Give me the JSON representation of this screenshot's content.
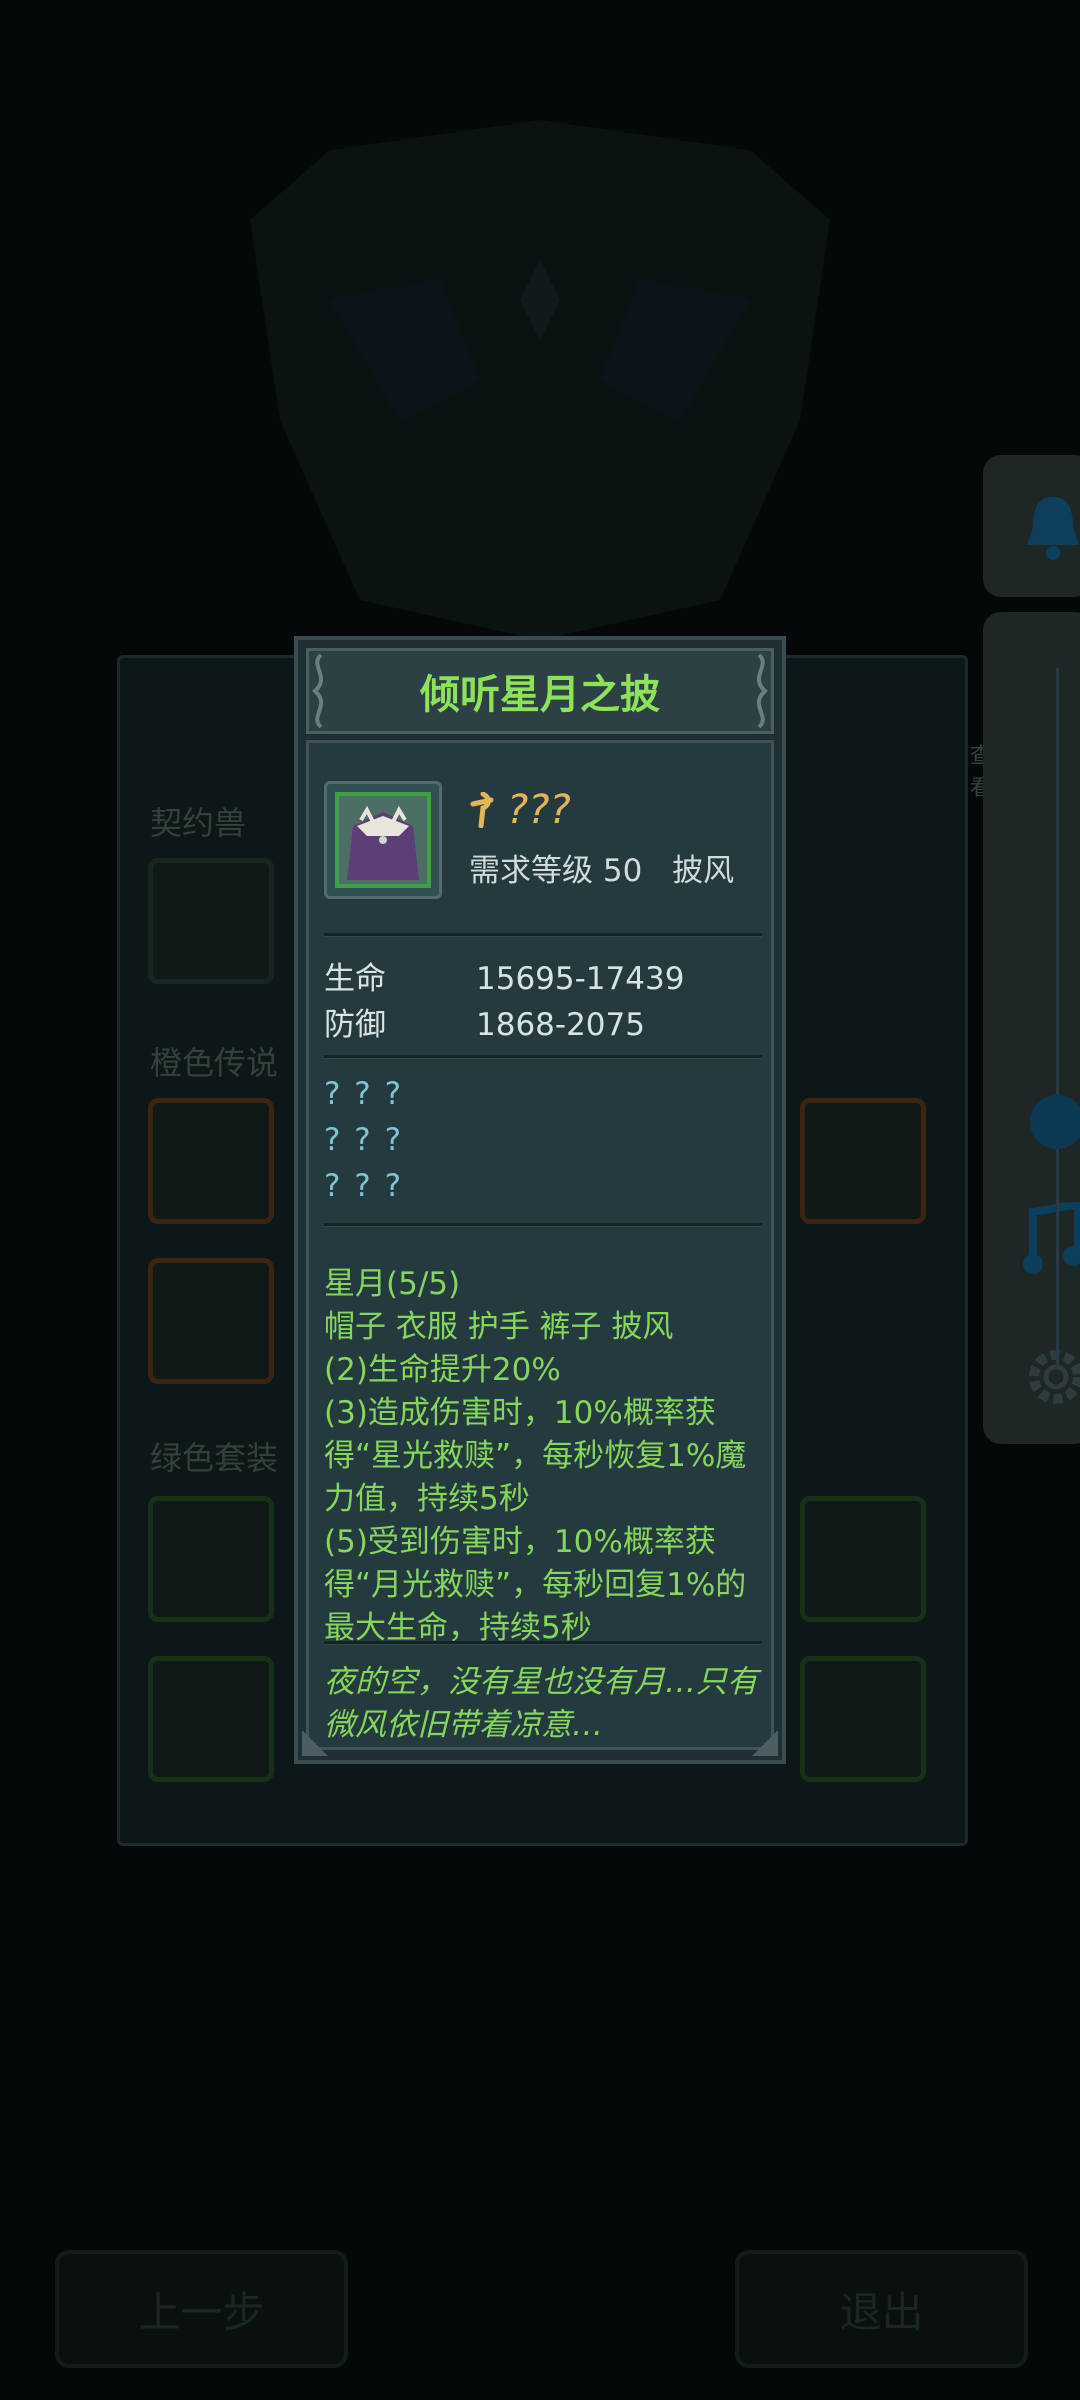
{
  "background": {
    "sections": [
      "契约兽",
      "橙色传说",
      "绿色套装"
    ],
    "side_tab_label": "查看",
    "buttons": {
      "back": "上一步",
      "exit": "退出"
    },
    "side_icons": [
      "bell-icon",
      "music-icon",
      "gear-icon"
    ]
  },
  "item": {
    "title": "倾听星月之披",
    "icon": "cloak-icon",
    "name": "???",
    "level_requirement": "需求等级 50",
    "slot_type": "披风",
    "stats": [
      {
        "label": "生命",
        "value": "15695-17439"
      },
      {
        "label": "防御",
        "value": "1868-2075"
      }
    ],
    "unknown_affixes": [
      "? ? ?",
      "? ? ?",
      "? ? ?"
    ],
    "set": {
      "name": "星月(5/5)",
      "pieces": "帽子 衣服 护手 裤子 披风",
      "bonuses": [
        "(2)生命提升20%",
        "(3)造成伤害时，10%概率获得“星光救赎”，每秒恢复1%魔力值，持续5秒",
        "(5)受到伤害时，10%概率获得“月光救赎”，每秒回复1%的最大生命，持续5秒"
      ]
    },
    "flavor_text": "夜的空，没有星也没有月…只有微风依旧带着凉意…"
  },
  "colors": {
    "title_green": "#8de25a",
    "name_gold": "#e3b55a",
    "set_green": "#86d65c",
    "unknown_cyan": "#7fc4d3"
  }
}
